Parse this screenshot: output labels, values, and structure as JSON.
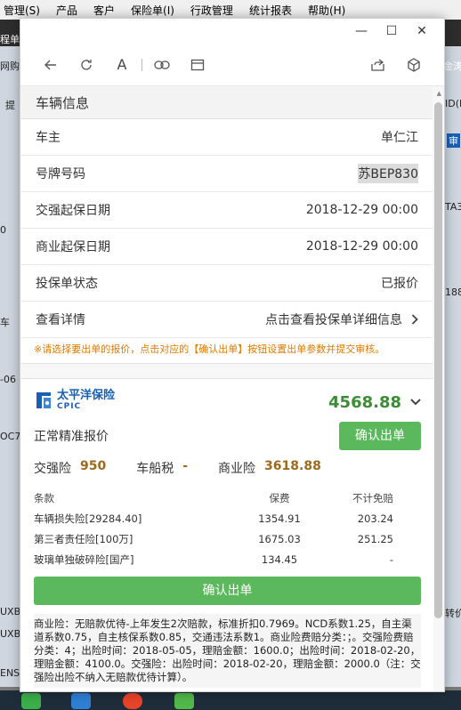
{
  "background_app": {
    "menu": [
      "管理(S)",
      "产品",
      "客户",
      "保险单(I)",
      "行政管理",
      "统计报表",
      "帮助(H)"
    ],
    "fragments": {
      "left": [
        "程单",
        "网购",
        "提",
        "0",
        "车",
        "-06",
        "OC7",
        "UXB",
        "UXB",
        "ENS"
      ],
      "right": [
        "金涛",
        "ID(P",
        "审",
        "TA3",
        "188",
        "转价"
      ]
    }
  },
  "window": {
    "controls": {
      "minimize": "—",
      "maximize": "☐",
      "close": "✕"
    },
    "toolbar": {
      "back_icon": "arrow-left-icon",
      "refresh_icon": "refresh-icon",
      "font_label": "A",
      "link_icon": "link-icon",
      "tab_icon": "tab-icon",
      "share_icon": "share-icon",
      "cube_icon": "cube-icon"
    }
  },
  "vehicle": {
    "title": "车辆信息",
    "rows": [
      {
        "label": "车主",
        "value": "单仁江"
      },
      {
        "label": "号牌号码",
        "value": "苏BEP830"
      },
      {
        "label": "交强起保日期",
        "value": "2018-12-29 00:00"
      },
      {
        "label": "商业起保日期",
        "value": "2018-12-29 00:00"
      },
      {
        "label": "投保单状态",
        "value": "已报价"
      },
      {
        "label": "查看详情",
        "value": "点击查看投保单详细信息"
      }
    ],
    "tip": "※请选择要出单的报价，点击对应的【确认出单】按钮设置出单参数并提交审核。"
  },
  "quote": {
    "insurer_cn": "太平洋保险",
    "insurer_en": "CPIC",
    "total": "4568.88",
    "quote_type": "正常精准报价",
    "confirm_label": "确认出单",
    "premiums": [
      {
        "label": "交强险",
        "value": "950"
      },
      {
        "label": "车船税",
        "value": "-"
      },
      {
        "label": "商业险",
        "value": "3618.88"
      }
    ],
    "table": {
      "headers": [
        "条款",
        "保费",
        "不计免赔"
      ],
      "rows": [
        [
          "车辆损失险[29284.40]",
          "1354.91",
          "203.24"
        ],
        [
          "第三者责任险[100万]",
          "1675.03",
          "251.25"
        ],
        [
          "玻璃单独破碎险[国产]",
          "134.45",
          "-"
        ]
      ]
    },
    "confirm_wide_label": "确认出单",
    "remark": "商业险：无赔款优待-上年发生2次赔款，标准折扣0.7969。NCD系数1.25，自主渠道系数0.75，自主核保系数0.85，交通违法系数1。商业险费赔分类：；。交强险费赔分类：4；出险时间：2018-05-05，理赔金额：1600.0；出险时间：2018-02-20，理赔金额：4100.0。交强险：出险时间：2018-02-20，理赔金额：2000.0（注：交强险出险不纳入无赔款优待计算）。"
  },
  "colors": {
    "accent_green": "#5cb85c",
    "total_green": "#3d8b37",
    "premium_gold": "#9c6a1c",
    "tip_orange": "#e07a00",
    "brand_blue": "#1a5fb4"
  }
}
